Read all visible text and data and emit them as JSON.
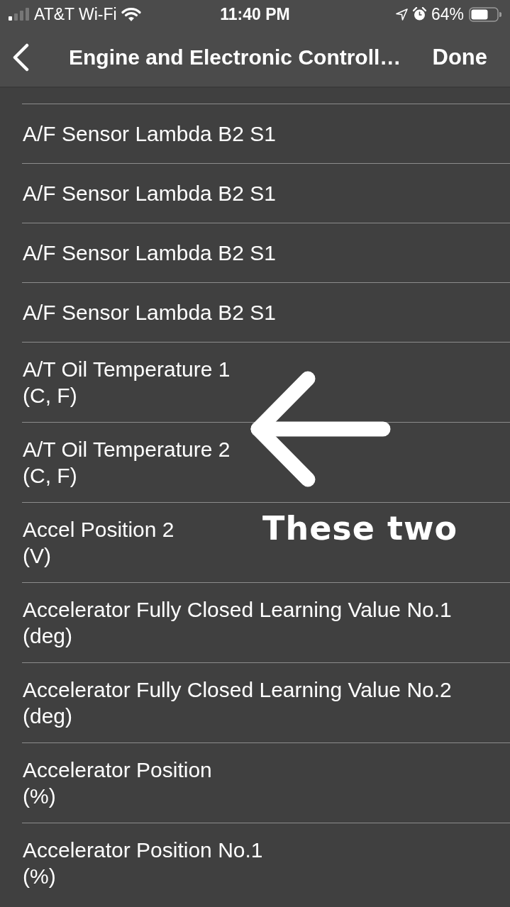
{
  "status_bar": {
    "carrier": "AT&T Wi-Fi",
    "time": "11:40 PM",
    "battery": "64%"
  },
  "navigation_bar": {
    "title": "Engine and Electronic Controll…",
    "done_button": "Done"
  },
  "parameters": [
    {
      "name": "A/F Sensor Lambda B2 S1"
    },
    {
      "name": "A/F Sensor Lambda B2 S1"
    },
    {
      "name": "A/F Sensor Lambda B2 S1"
    },
    {
      "name": "A/F Sensor Lambda B2 S1"
    },
    {
      "name": "A/T Oil Temperature 1",
      "unit": "(C, F)"
    },
    {
      "name": "A/T Oil Temperature 2",
      "unit": "(C, F)"
    },
    {
      "name": "Accel Position 2",
      "unit": "(V)"
    },
    {
      "name": "Accelerator Fully Closed Learning Value No.1",
      "unit": "(deg)"
    },
    {
      "name": "Accelerator Fully Closed Learning Value No.2",
      "unit": "(deg)"
    },
    {
      "name": "Accelerator Position",
      "unit": "(%)"
    },
    {
      "name": "Accelerator Position No.1",
      "unit": "(%)"
    }
  ],
  "annotation": {
    "text": "These two"
  }
}
